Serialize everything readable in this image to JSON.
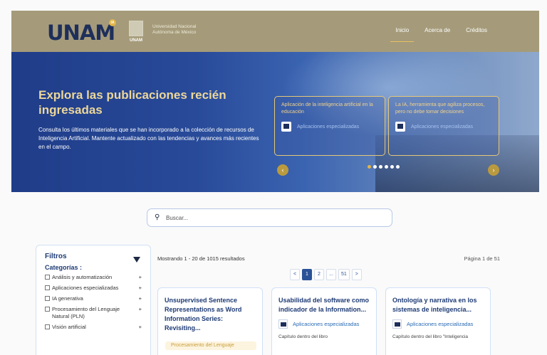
{
  "header": {
    "logo_text": "UNAM",
    "logo_badge": "IA",
    "seal_text": "UNAM",
    "university_line1": "Universidad Nacional",
    "university_line2": "Autónoma de México",
    "nav": [
      "Inicio",
      "Acerca de",
      "Créditos"
    ],
    "active_nav": "Inicio",
    "colors": {
      "header_bg": "#a59b7a",
      "accent": "#e8c060"
    }
  },
  "hero": {
    "title": "Explora las publicaciones recién ingresadas",
    "description": "Consulta los últimos materiales que se han incorporado a la colección de recursos de Inteligencia Artificial. Mantente actualizado con las tendencias y avances más recientes en el campo.",
    "cards": [
      {
        "title": "Aplicación de la inteligencia artificial en la educación",
        "category": "Aplicaciones especializadas"
      },
      {
        "title": "La IA, herramienta que agiliza procesos, pero no debe tomar decisiones",
        "category": "Aplicaciones especializadas"
      }
    ],
    "prev_icon": "chevron-left-icon",
    "next_icon": "chevron-right-icon",
    "slide_count": 6,
    "active_slide": 1
  },
  "search": {
    "placeholder": "Buscar...",
    "icon": "search-icon"
  },
  "filters": {
    "title": "Filtros",
    "category_heading": "Categorías :",
    "options": [
      {
        "label": "Análisis y automatización",
        "expand": "+"
      },
      {
        "label": "Aplicaciones especializadas",
        "expand": "+"
      },
      {
        "label": "IA generativa",
        "expand": "+"
      },
      {
        "label": "Procesamiento del Lenguaje Natural (PLN)",
        "expand": "+"
      },
      {
        "label": "Visión artificial",
        "expand": "+"
      }
    ]
  },
  "results": {
    "summary": "Mostrando 1 - 20 de 1015 resultados",
    "page_label": "Página 1 de 51",
    "pagination": [
      "<",
      "1",
      "2",
      "...",
      "51",
      ">"
    ],
    "current_page": "1"
  },
  "cards": [
    {
      "title": "Unsupervised Sentence Representations as Word Information Series: Revisiting...",
      "category": "",
      "description": "",
      "tag": "Procesamiento del Lenguaje"
    },
    {
      "title": "Usabilidad del software como indicador de la Information...",
      "category": "Aplicaciones especializadas",
      "description": "Capítulo dentro del libro",
      "tag": ""
    },
    {
      "title": "Ontología y narrativa en los sistemas de inteligencia...",
      "category": "Aplicaciones especializadas",
      "description": "Capítulo dentro del libro \"Inteligencia",
      "tag": ""
    }
  ]
}
